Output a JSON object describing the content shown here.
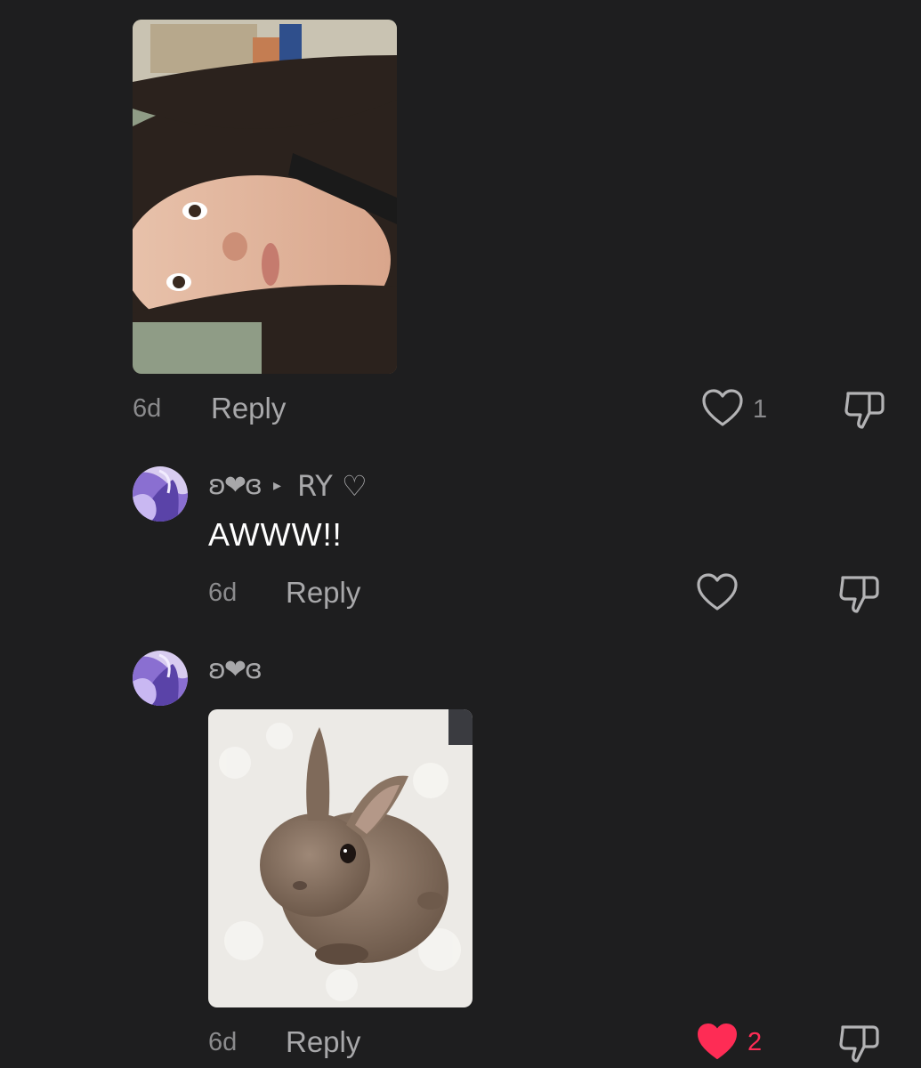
{
  "comments": [
    {
      "image": "selfie-photo",
      "time": "6d",
      "reply_label": "Reply",
      "like_count": "1",
      "liked": false
    },
    {
      "username": "ʚ❤ɞ",
      "username_arrow": "▸",
      "username_suffix": "RY ♡",
      "text": "AWWW!!",
      "time": "6d",
      "reply_label": "Reply",
      "like_count": "",
      "liked": false
    },
    {
      "username": "ʚ❤ɞ",
      "image": "bunny-photo",
      "time": "6d",
      "reply_label": "Reply",
      "like_count": "2",
      "liked": true
    }
  ],
  "colors": {
    "background": "#1e1e1f",
    "liked": "#fe2c55",
    "muted": "#8b8b8d"
  }
}
